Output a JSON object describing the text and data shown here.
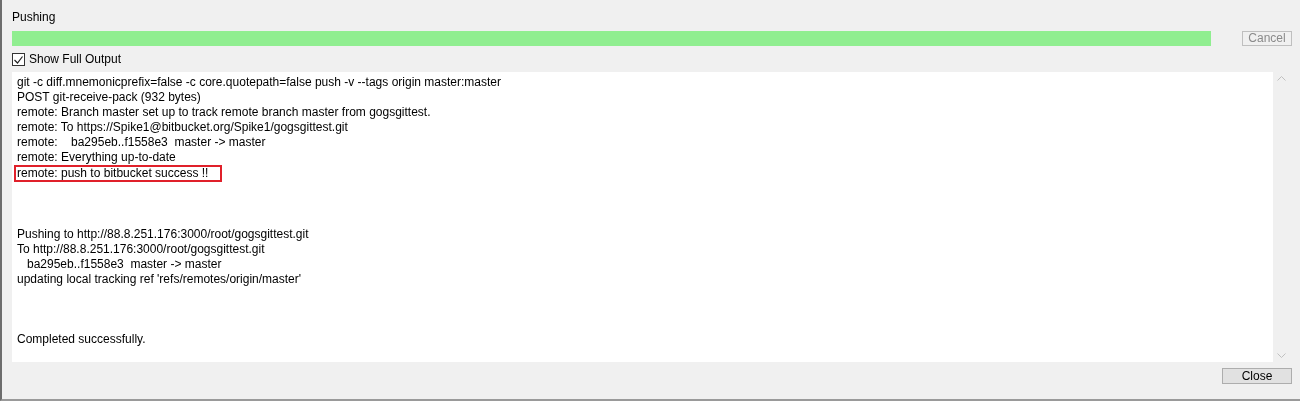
{
  "title": "Pushing",
  "progress": {
    "level": 1
  },
  "cancel_button": {
    "label": "Cancel",
    "disabled": true
  },
  "show_full_output": {
    "label": "Show Full Output",
    "checked": true
  },
  "output": {
    "blocks": [
      {
        "lines": [
          {
            "text": "git -c diff.mnemonicprefix=false -c core.quotepath=false push -v --tags origin master:master",
            "highlighted": false
          },
          {
            "text": "POST git-receive-pack (932 bytes)",
            "highlighted": false
          },
          {
            "text": "remote: Branch master set up to track remote branch master from gogsgittest.",
            "highlighted": false
          },
          {
            "text": "remote: To https://Spike1@bitbucket.org/Spike1/gogsgittest.git",
            "highlighted": false
          },
          {
            "text": "remote:    ba295eb..f1558e3  master -> master",
            "highlighted": false
          },
          {
            "text": "remote: Everything up-to-date",
            "highlighted": false
          },
          {
            "text": "remote: push to bitbucket success !!",
            "highlighted": true
          }
        ]
      },
      {
        "lines": [
          {
            "text": "Pushing to http://88.8.251.176:3000/root/gogsgittest.git",
            "highlighted": false
          },
          {
            "text": "To http://88.8.251.176:3000/root/gogsgittest.git",
            "highlighted": false
          },
          {
            "text": "   ba295eb..f1558e3  master -> master",
            "highlighted": false
          },
          {
            "text": "updating local tracking ref 'refs/remotes/origin/master'",
            "highlighted": false
          }
        ]
      },
      {
        "lines": [
          {
            "text": "Completed successfully.",
            "highlighted": false
          }
        ]
      }
    ]
  },
  "close_button": {
    "label": "Close"
  }
}
